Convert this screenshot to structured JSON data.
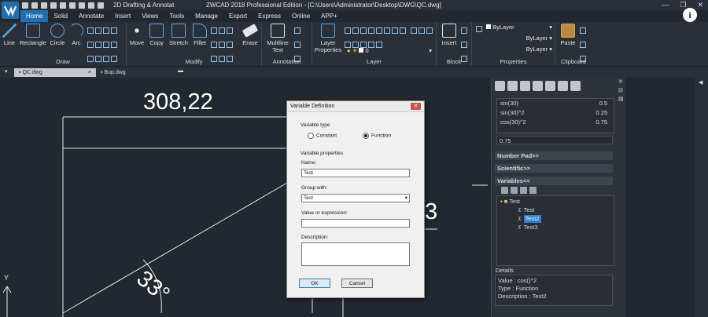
{
  "titlebar": {
    "workspace": "2D Drafting & Annotat",
    "app_title": "ZWCAD 2018 Professional Edition - [C:\\Users\\Administrator\\Desktop\\DWG\\QC.dwg]",
    "window_controls": [
      "—",
      "❐",
      "✕"
    ]
  },
  "menu": {
    "tabs": [
      "Home",
      "Solid",
      "Annotate",
      "Insert",
      "Views",
      "Tools",
      "Manage",
      "Export",
      "Express",
      "Online",
      "APP+"
    ],
    "active": "Home"
  },
  "ribbon": {
    "draw": {
      "label": "Draw",
      "tools": [
        "Line",
        "Rectangle",
        "Circle",
        "Arc"
      ]
    },
    "modify": {
      "label": "Modify",
      "tools": [
        "Move",
        "Copy",
        "Stretch",
        "Fillet",
        "Erase"
      ]
    },
    "annotation": {
      "label": "Annotation",
      "tool": "Multiline Text"
    },
    "layer": {
      "label": "Layer",
      "tool": "Layer Properties",
      "layer_value": "0"
    },
    "block": {
      "label": "Block",
      "tool": "Insert"
    },
    "properties": {
      "label": "Properties",
      "color": "ByLayer",
      "linetype": "ByLayer",
      "lineweight": "ByLayer"
    },
    "clipboard": {
      "label": "Clipboard",
      "tool": "Paste"
    }
  },
  "doc_tabs": [
    {
      "label": "QC.dwg",
      "active": true
    },
    {
      "label": "Bup.dwg",
      "active": false
    }
  ],
  "canvas": {
    "dimension_top": "308,22",
    "angle_label": "33°",
    "partial_label": "3",
    "axis_label": "Y"
  },
  "dialog": {
    "title": "Variable Definition",
    "variable_type_label": "Variable type",
    "type_options": [
      "Constant",
      "Function"
    ],
    "selected_type": "Function",
    "properties_label": "Variable properties",
    "name_label": "Name:",
    "name_value": "Test",
    "group_label": "Group with:",
    "group_value": "Test",
    "value_label": "Value or expression:",
    "value_value": "",
    "description_label": "Description:",
    "description_value": "",
    "ok_label": "OK",
    "cancel_label": "Cancel"
  },
  "calculator": {
    "history": [
      {
        "expr": "sin(30)",
        "value": "0.5"
      },
      {
        "expr": "sin(30)^2",
        "value": "0.25"
      },
      {
        "expr": "cos(30)^2",
        "value": "0.75"
      }
    ],
    "current_value": "0.75",
    "number_pad_label": "Number Pad>>",
    "scientific_label": "Scientific>>",
    "variables_label": "Variables<<",
    "tree": {
      "group": "Test",
      "items": [
        "Test",
        "Test2",
        "Test3"
      ],
      "selected": "Test2"
    },
    "details_label": "Details",
    "details": {
      "value": "Value : cos()^2",
      "type": "Type : Function",
      "description": "Description : Test2"
    }
  },
  "colors": {
    "accent": "#1f6fb5",
    "canvas_bg": "#212830",
    "selection": "#2f7fcf"
  }
}
